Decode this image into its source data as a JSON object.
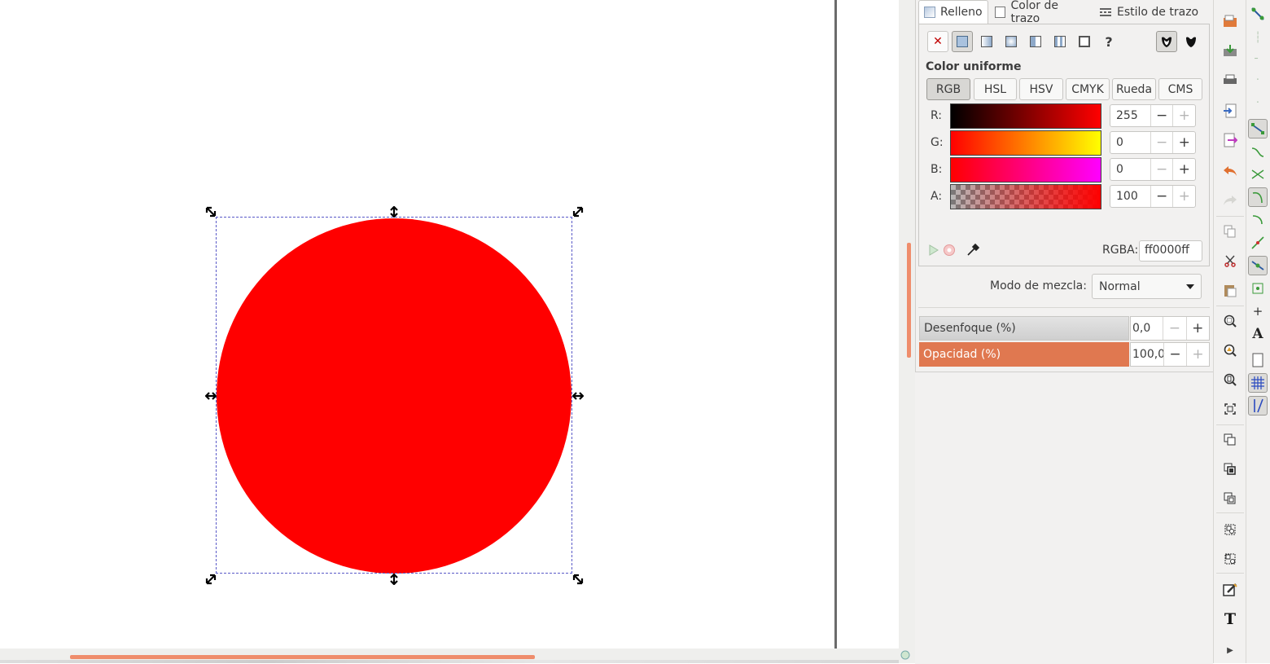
{
  "tabs": [
    {
      "label": "Relleno",
      "active": true
    },
    {
      "label": "Color de trazo",
      "active": false
    },
    {
      "label": "Estilo de trazo",
      "active": false
    }
  ],
  "paint_types": [
    "no-paint-icon",
    "flat-color-icon",
    "linear-gradient-icon",
    "radial-gradient-icon",
    "mesh-gradient-icon",
    "pattern-icon",
    "swatch-icon",
    "unset-paint-icon"
  ],
  "paint_type_selected": "flat-color-icon",
  "unset_label": "?",
  "fill_rule_icons": [
    "fill-rule-evenodd-icon",
    "fill-rule-nonzero-icon"
  ],
  "color": {
    "title": "Color uniforme",
    "modes": [
      "RGB",
      "HSL",
      "HSV",
      "CMYK",
      "Rueda",
      "CMS"
    ],
    "selected_mode": "RGB",
    "channels": [
      {
        "label": "R:",
        "value": "255"
      },
      {
        "label": "G:",
        "value": "0"
      },
      {
        "label": "B:",
        "value": "0"
      },
      {
        "label": "A:",
        "value": "100"
      }
    ],
    "rgba_label": "RGBA:",
    "rgba_value": "ff0000ff",
    "fill_color": "#ff0000"
  },
  "blend": {
    "label": "Modo de mezcla:",
    "value": "Normal"
  },
  "blur": {
    "label": "Desenfoque (%)",
    "value": "0,0"
  },
  "opacity": {
    "label": "Opacidad (%)",
    "value": "100,0"
  },
  "spin_minus": "−",
  "spin_plus": "+",
  "colors": {
    "accent": "#e07850",
    "scroll_thumb": "#ef8d6c",
    "canvas_bg": "#ffffff"
  },
  "commands": [
    "open-icon",
    "save-icon",
    "print-icon",
    "import-icon",
    "export-icon",
    "undo-icon",
    "redo-icon",
    "copy-icon",
    "cut-icon",
    "paste-icon",
    "zoom-selection-icon",
    "zoom-drawing-icon",
    "zoom-page-icon",
    "zoom-resize-icon",
    "duplicate-icon",
    "clone-icon",
    "unlink-clone-icon",
    "group-icon",
    "ungroup-icon",
    "fill-stroke-icon",
    "text-font-icon",
    "more-icon"
  ],
  "snap_controls": [
    "snap-toggle-icon",
    "snap-bbox-icon",
    "snap-bbox-edges-icon",
    "snap-bbox-corners-icon",
    "snap-bbox-midpoints-icon",
    "snap-nodes-icon",
    "snap-paths-icon",
    "snap-intersections-icon",
    "snap-cusp-nodes-icon",
    "snap-smooth-nodes-icon",
    "snap-midpoints-icon",
    "snap-others-icon",
    "snap-centers-icon",
    "snap-rotation-center-icon",
    "snap-text-baseline-icon",
    "snap-page-border-icon",
    "snap-grid-icon",
    "snap-guide-icon"
  ],
  "text_tool_glyph": "T",
  "text_snap_glyph": "A"
}
